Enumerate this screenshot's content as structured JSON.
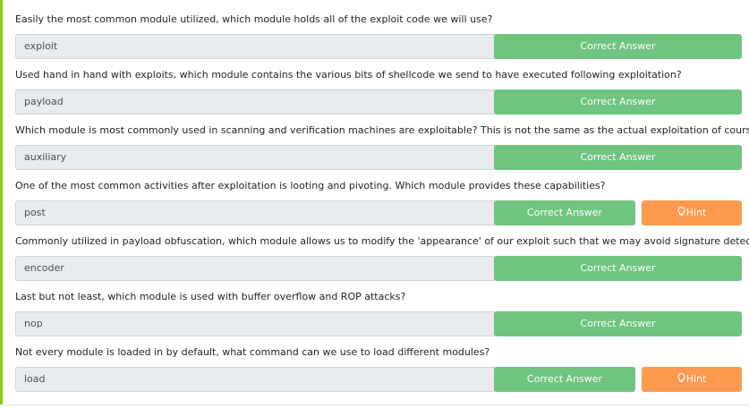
{
  "correct_label": "Correct Answer",
  "hint_label": "Hint",
  "questions": [
    {
      "text": "Easily the most common module utilized, which module holds all of the exploit code we will use?",
      "answer": "exploit"
    },
    {
      "text": "Used hand in hand with exploits, which module contains the various bits of shellcode we send to have executed following exploitation?",
      "answer": "payload"
    },
    {
      "text": "Which module is most commonly used in scanning and verification machines are exploitable? This is not the same as the actual exploitation of course.",
      "answer": "auxiliary"
    },
    {
      "text": "One of the most common activities after exploitation is looting and pivoting. Which module provides these capabilities?",
      "answer": "post"
    },
    {
      "text": "Commonly utilized in payload obfuscation, which module allows us to modify the 'appearance' of our exploit such that we may avoid signature detection?",
      "answer": "encoder"
    },
    {
      "text": "Last but not least, which module is used with buffer overflow and ROP attacks?",
      "answer": "nop"
    },
    {
      "text": "Not every module is loaded in by default, what command can we use to load different modules?",
      "answer": "load"
    }
  ],
  "colors": {
    "correct": "#6fc57f",
    "hint": "#fd9a4f",
    "accent": "#88cc14"
  }
}
